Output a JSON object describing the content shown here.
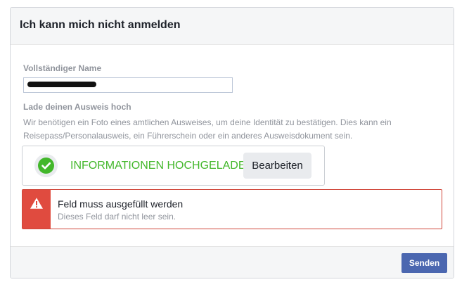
{
  "dialog": {
    "title": "Ich kann mich nicht anmelden"
  },
  "form": {
    "name_label": "Vollständiger Name",
    "name_value": "",
    "upload_heading": "Lade deinen Ausweis hoch",
    "upload_description": "Wir benötigen ein Foto eines amtlichen Ausweises, um deine Identität zu bestätigen. Dies kann ein Reisepass/Personalausweis, ein Führerschein oder ein anderes Ausweisdokument sein.",
    "upload_status": "INFORMATIONEN HOCHGELADEN",
    "edit_label": "Bearbeiten"
  },
  "error": {
    "title": "Feld muss ausgefüllt werden",
    "message": "Dieses Feld darf nicht leer sein."
  },
  "footer": {
    "send_label": "Senden"
  },
  "icons": {
    "success": "check-circle-icon",
    "warning": "warning-triangle-icon"
  },
  "colors": {
    "success": "#42b72a",
    "error": "#e04b3f",
    "primary_button": "#4b67b0",
    "header_bg": "#f5f6f7"
  }
}
